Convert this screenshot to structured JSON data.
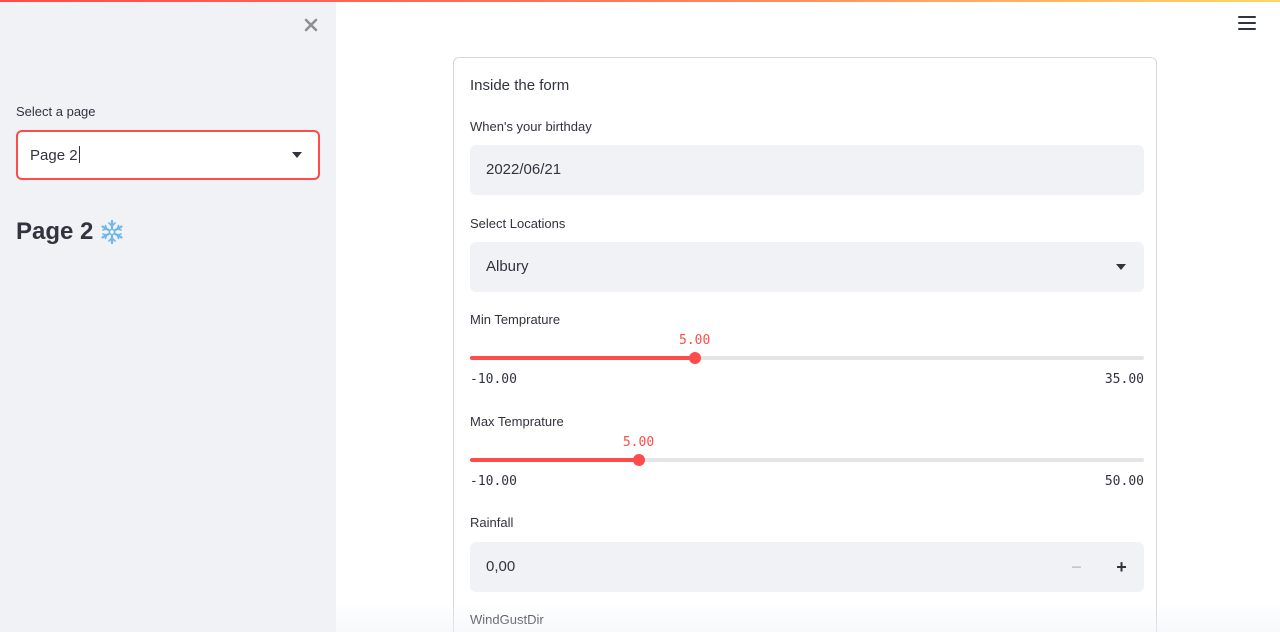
{
  "sidebar": {
    "select_label": "Select a page",
    "select_value": "Page 2",
    "page_heading": "Page 2"
  },
  "form": {
    "title": "Inside the form",
    "birthday": {
      "label": "When's your birthday",
      "value": "2022/06/21"
    },
    "locations": {
      "label": "Select Locations",
      "value": "Albury"
    },
    "min_temp": {
      "label": "Min Temprature",
      "value": 5,
      "value_label": "5.00",
      "min": -10,
      "max": 35,
      "min_label": "-10.00",
      "max_label": "35.00"
    },
    "max_temp": {
      "label": "Max Temprature",
      "value": 5,
      "value_label": "5.00",
      "min": -10,
      "max": 50,
      "min_label": "-10.00",
      "max_label": "50.00"
    },
    "rainfall": {
      "label": "Rainfall",
      "value": "0,00",
      "minus": "−",
      "plus": "+"
    },
    "windgustdir": {
      "label": "WindGustDir"
    }
  },
  "colors": {
    "accent": "#ff4b4b",
    "sidebar_bg": "#f0f2f6",
    "field_bg": "#f0f2f6",
    "text": "#31333f"
  },
  "icons": {
    "close": "close-icon",
    "menu": "hamburger-menu-icon",
    "dropdown": "chevron-down-icon",
    "heading_emoji": "snowflake-icon"
  }
}
